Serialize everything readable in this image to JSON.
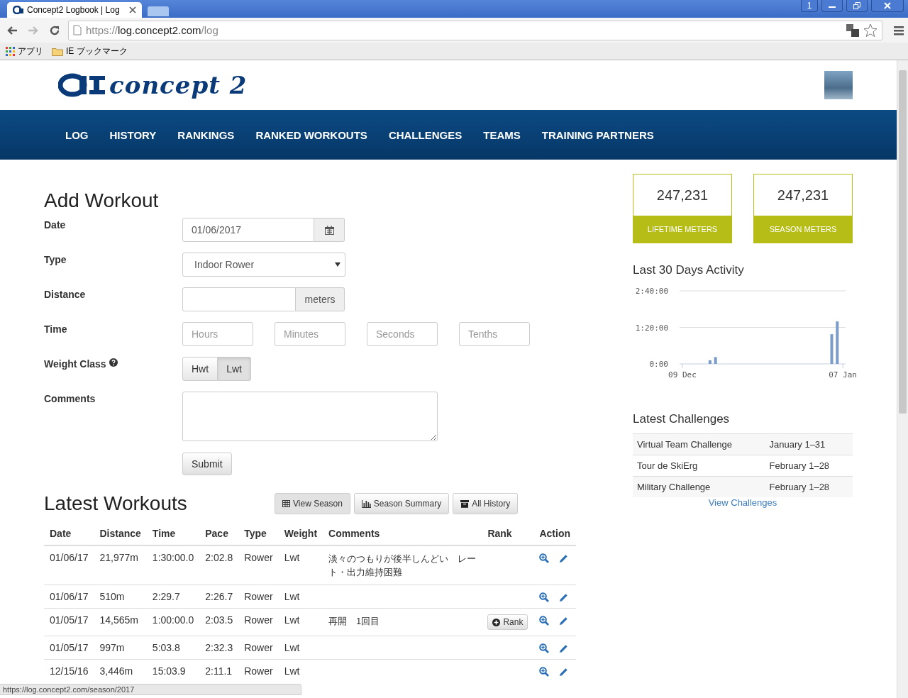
{
  "browser": {
    "tab_title": "Concept2 Logbook | Log",
    "window_badge": "1",
    "url_scheme": "https://",
    "url_host": "log.concept2.com",
    "url_path": "/log",
    "bookmarks": [
      "アプリ",
      "IE ブックマーク"
    ],
    "status_url": "https://log.concept2.com/season/2017"
  },
  "header": {
    "logo_text": "concept 2"
  },
  "nav": [
    "LOG",
    "HISTORY",
    "RANKINGS",
    "RANKED WORKOUTS",
    "CHALLENGES",
    "TEAMS",
    "TRAINING PARTNERS"
  ],
  "add_workout": {
    "title": "Add Workout",
    "date": {
      "label": "Date",
      "value": "01/06/2017"
    },
    "type": {
      "label": "Type",
      "value": "Indoor Rower"
    },
    "distance": {
      "label": "Distance",
      "unit": "meters"
    },
    "time": {
      "label": "Time",
      "placeholders": [
        "Hours",
        "Minutes",
        "Seconds",
        "Tenths"
      ]
    },
    "weight_class": {
      "label": "Weight Class",
      "options": [
        {
          "label": "Hwt",
          "selected": false
        },
        {
          "label": "Lwt",
          "selected": true
        }
      ]
    },
    "comments": {
      "label": "Comments"
    },
    "submit": "Submit"
  },
  "latest_workouts": {
    "title": "Latest Workouts",
    "buttons": [
      {
        "kind": "table",
        "label": "View Season"
      },
      {
        "kind": "chart",
        "label": "Season Summary"
      },
      {
        "kind": "archive",
        "label": "All History"
      }
    ],
    "columns": [
      "Date",
      "Distance",
      "Time",
      "Pace",
      "Type",
      "Weight",
      "Comments",
      "Rank",
      "Action"
    ],
    "rows": [
      {
        "date": "01/06/17",
        "distance": "21,977m",
        "time": "1:30:00.0",
        "pace": "2:02.8",
        "type": "Rower",
        "weight": "Lwt",
        "comments": "淡々のつもりが後半しんどい　レート・出力維持困難"
      },
      {
        "date": "01/06/17",
        "distance": "510m",
        "time": "2:29.7",
        "pace": "2:26.7",
        "type": "Rower",
        "weight": "Lwt"
      },
      {
        "date": "01/05/17",
        "distance": "14,565m",
        "time": "1:00:00.0",
        "pace": "2:03.5",
        "type": "Rower",
        "weight": "Lwt",
        "comments": "再開　1回目",
        "rank_button": "Rank"
      },
      {
        "date": "01/05/17",
        "distance": "997m",
        "time": "5:03.8",
        "pace": "2:32.3",
        "type": "Rower",
        "weight": "Lwt"
      },
      {
        "date": "12/15/16",
        "distance": "3,446m",
        "time": "15:03.9",
        "pace": "2:11.1",
        "type": "Rower",
        "weight": "Lwt"
      }
    ]
  },
  "stats": [
    {
      "value": "247,231",
      "label": "LIFETIME METERS"
    },
    {
      "value": "247,231",
      "label": "SEASON METERS"
    }
  ],
  "activity": {
    "title": "Last 30 Days Activity",
    "chart_data": {
      "type": "bar",
      "categories": [
        "09 Dec",
        null,
        null,
        null,
        null,
        null,
        null,
        null,
        null,
        null,
        null,
        null,
        null,
        null,
        null,
        null,
        null,
        null,
        null,
        null,
        null,
        null,
        null,
        null,
        null,
        null,
        null,
        null,
        null,
        "07 Jan"
      ],
      "series": [
        {
          "color": "#7b9cc8",
          "values": [
            0,
            0,
            0,
            0,
            0,
            8,
            15,
            0,
            0,
            0,
            0,
            0,
            0,
            0,
            0,
            0,
            0,
            0,
            0,
            0,
            0,
            0,
            0,
            0,
            0,
            0,
            0,
            65,
            93,
            0
          ]
        }
      ],
      "ylim": [
        0,
        160
      ],
      "yticks": [
        {
          "value": 0,
          "label": "0:00"
        },
        {
          "value": 80,
          "label": "1:20:00"
        },
        {
          "value": 160,
          "label": "2:40:00"
        }
      ]
    }
  },
  "challenges": {
    "title": "Latest Challenges",
    "rows": [
      {
        "name": "Virtual Team Challenge",
        "dates": "January 1–31"
      },
      {
        "name": "Tour de SkiErg",
        "dates": "February 1–28"
      },
      {
        "name": "Military Challenge",
        "dates": "February 1–28"
      }
    ],
    "link": "View Challenges"
  }
}
